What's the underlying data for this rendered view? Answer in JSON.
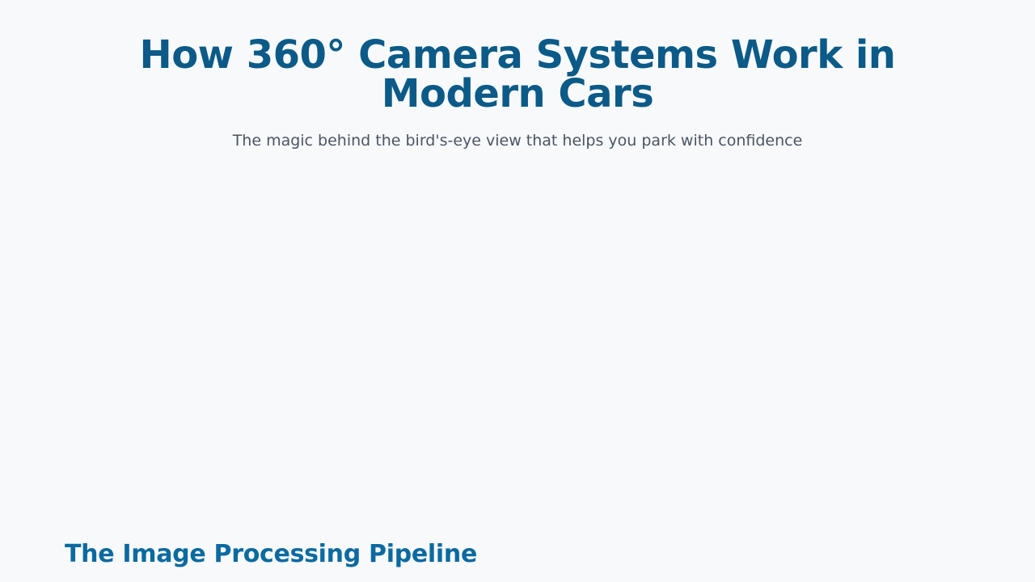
{
  "header": {
    "title": "How 360° Camera Systems Work in Modern Cars",
    "subtitle": "The magic behind the bird's-eye view that helps you park with confidence"
  },
  "sections": [
    {
      "heading": "The Image Processing Pipeline"
    }
  ],
  "colors": {
    "background": "#f7f9fb",
    "title": "#0b5a87",
    "subtitle": "#4b5563",
    "section_heading": "#0b6aa0"
  }
}
